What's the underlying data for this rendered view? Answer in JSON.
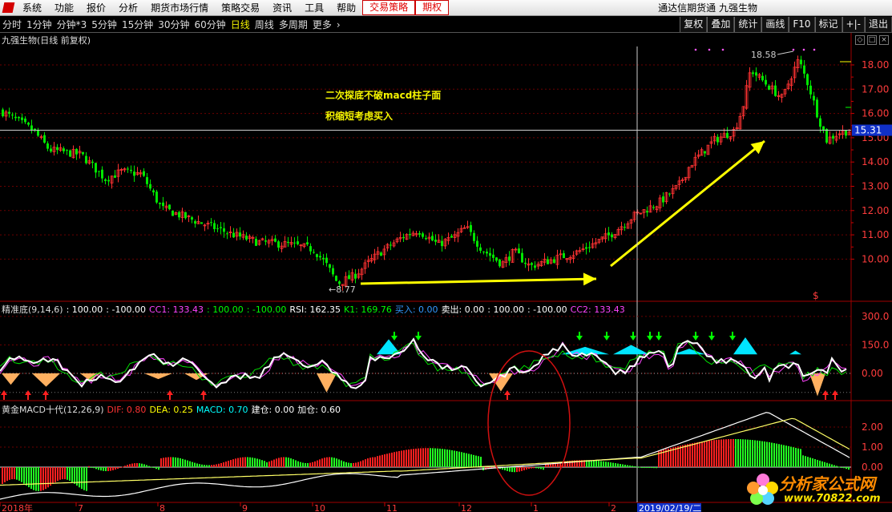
{
  "menu": {
    "items": [
      "系统",
      "功能",
      "报价",
      "分析",
      "期货市场行情",
      "策略交易",
      "资讯",
      "工具",
      "帮助",
      "交易策略",
      "期权"
    ],
    "highlighted": [
      "交易策略",
      "期权"
    ],
    "app_title": "通达信期货通",
    "stock_title": "九强生物"
  },
  "toolbar": {
    "periods": [
      "分时",
      "1分钟",
      "分钟*3",
      "5分钟",
      "15分钟",
      "30分钟",
      "60分钟",
      "日线",
      "周线",
      "多周期",
      "更多"
    ],
    "active_period": "日线",
    "right_buttons": [
      "复权",
      "叠加",
      "统计",
      "画线",
      "F10",
      "标记",
      "+|-",
      "退出"
    ]
  },
  "main_pane": {
    "title": "九强生物(日线 前复权)",
    "price_axis": [
      "18.00",
      "17.00",
      "16.00",
      "15.00",
      "14.00",
      "13.00",
      "12.00",
      "11.00",
      "10.00"
    ],
    "current_price": "15.31",
    "high_label": "18.58",
    "low_label": "8.77",
    "annotation_line1": "二次探底不破macd柱子面",
    "annotation_line2": "积缩短考虑买入",
    "dollar_marker": "$"
  },
  "indicator_pane": {
    "name": "精准底(9,14,6)",
    "values": [
      {
        "text": ": 100.00",
        "color": "#ffffff"
      },
      {
        "text": ": -100.00",
        "color": "#ffffff"
      },
      {
        "text": "CC1: 133.43",
        "color": "#ff44ff"
      },
      {
        "text": ": 100.00",
        "color": "#00ff00"
      },
      {
        "text": ": -100.00",
        "color": "#00ff00"
      },
      {
        "text": "RSI: 162.35",
        "color": "#ffffff"
      },
      {
        "text": "K1: 169.76",
        "color": "#00ff00"
      },
      {
        "text": "买入: 0.00",
        "color": "#3399ff"
      },
      {
        "text": "卖出: 0.00",
        "color": "#ffffff"
      },
      {
        "text": ": 100.00",
        "color": "#ffffff"
      },
      {
        "text": ": -100.00",
        "color": "#ffffff"
      },
      {
        "text": "CC2: 133.43",
        "color": "#ff44ff"
      }
    ],
    "axis": [
      "300.0",
      "150.0",
      "0.00"
    ]
  },
  "macd_pane": {
    "name": "黄金MACD十代(12,26,9)",
    "values": [
      {
        "text": "DIF: 0.80",
        "color": "#ff3333"
      },
      {
        "text": "DEA: 0.25",
        "color": "#ffff00"
      },
      {
        "text": "MACD: 0.70",
        "color": "#00ffff"
      },
      {
        "text": "建仓: 0.00",
        "color": "#ffffff"
      },
      {
        "text": "加仓: 0.60",
        "color": "#ffffff"
      }
    ],
    "axis": [
      "2.00",
      "1.00",
      "0.00"
    ]
  },
  "date_axis": {
    "labels": [
      "2018年",
      "7",
      "8",
      "9",
      "10",
      "11",
      "12",
      "1",
      "2"
    ],
    "cursor_date": "2019/02/19/二"
  },
  "watermark": {
    "site": "分析家公式网",
    "url": "www.70822.com"
  },
  "colors": {
    "up": "#ff3232",
    "down": "#00e600",
    "grid": "#8b0000",
    "arrow": "#ffff00"
  }
}
